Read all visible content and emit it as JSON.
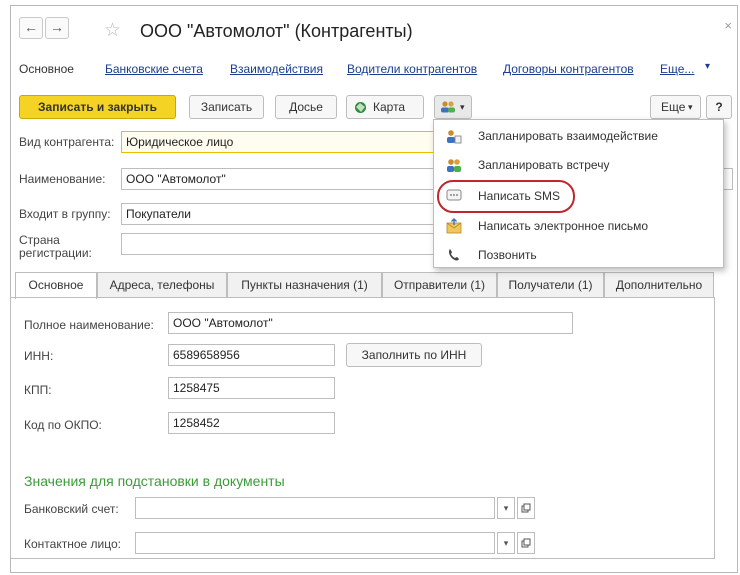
{
  "window": {
    "title": "ООО \"Автомолот\" (Контрагенты)",
    "close_glyph": "×",
    "back_glyph": "←",
    "forward_glyph": "→",
    "star_glyph": "☆"
  },
  "nav": {
    "current": "Основное",
    "links": [
      "Банковские счета",
      "Взаимодействия",
      "Водители контрагентов",
      "Договоры контрагентов",
      "Еще..."
    ]
  },
  "toolbar": {
    "save_close": "Записать и закрыть",
    "save": "Записать",
    "dossier": "Досье",
    "map": "Карта",
    "more": "Еще",
    "help": "?",
    "dropdown_glyph": "▾"
  },
  "form": {
    "kind_label": "Вид контрагента:",
    "kind_value": "Юридическое лицо",
    "name_label": "Наименование:",
    "name_value": "ООО \"Автомолот\"",
    "group_label": "Входит в группу:",
    "group_value": "Покупатели",
    "country_label_1": "Страна",
    "country_label_2": "регистрации:",
    "country_value": ""
  },
  "tabs": [
    "Основное",
    "Адреса, телефоны",
    "Пункты назначения (1)",
    "Отправители (1)",
    "Получатели (1)",
    "Дополнительно"
  ],
  "main": {
    "fullname_label": "Полное наименование:",
    "fullname_value": "ООО \"Автомолот\"",
    "inn_label": "ИНН:",
    "inn_value": "6589658956",
    "fill_inn": "Заполнить по ИНН",
    "kpp_label": "КПП:",
    "kpp_value": "1258475",
    "okpo_label": "Код по ОКПО:",
    "okpo_value": "1258452",
    "section_title": "Значения для подстановки в документы",
    "bank_label": "Банковский счет:",
    "bank_value": "",
    "contact_label": "Контактное лицо:",
    "contact_value": ""
  },
  "menu": {
    "items": [
      "Запланировать взаимодействие",
      "Запланировать встречу",
      "Написать SMS",
      "Написать электронное письмо",
      "Позвонить"
    ],
    "highlight_color": "#c0262c"
  },
  "colors": {
    "primary_button": "#f4d324",
    "link": "#1a3d8f",
    "section_title": "#3c9a3c"
  }
}
